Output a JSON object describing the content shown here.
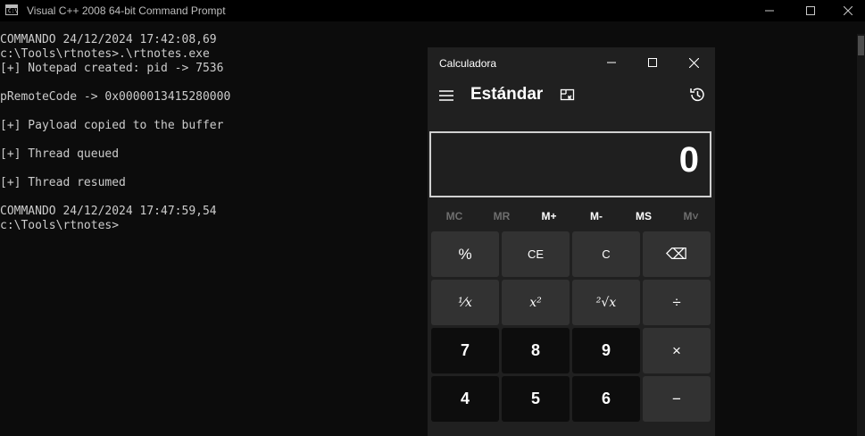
{
  "console": {
    "title": "Visual C++ 2008 64-bit Command Prompt",
    "lines": [
      "COMMANDO 24/12/2024 17:42:08,69",
      "c:\\Tools\\rtnotes>.\\rtnotes.exe",
      "[+] Notepad created: pid -> 7536",
      "",
      "pRemoteCode -> 0x0000013415280000",
      "",
      "[+] Payload copied to the buffer",
      "",
      "[+] Thread queued",
      "",
      "[+] Thread resumed",
      "",
      "COMMANDO 24/12/2024 17:47:59,54",
      "c:\\Tools\\rtnotes>"
    ]
  },
  "calculator": {
    "title": "Calculadora",
    "mode": "Estándar",
    "display": "0",
    "memory": [
      {
        "label": "MC",
        "enabled": false
      },
      {
        "label": "MR",
        "enabled": false
      },
      {
        "label": "M+",
        "enabled": true
      },
      {
        "label": "M-",
        "enabled": true
      },
      {
        "label": "MS",
        "enabled": true
      },
      {
        "label": "M˅",
        "enabled": false
      }
    ],
    "keys": [
      {
        "label": "%",
        "name": "percent-key",
        "style": "fn"
      },
      {
        "label": "CE",
        "name": "clear-entry-key",
        "style": "fn"
      },
      {
        "label": "C",
        "name": "clear-key",
        "style": "fn"
      },
      {
        "label": "⌫",
        "name": "backspace-key",
        "style": "fn",
        "icon": "backspace-icon"
      },
      {
        "label": "¹⁄x",
        "name": "reciprocal-key",
        "style": "fn"
      },
      {
        "label": "x²",
        "name": "square-key",
        "style": "fn"
      },
      {
        "label": "²√x",
        "name": "square-root-key",
        "style": "fn"
      },
      {
        "label": "÷",
        "name": "divide-key",
        "style": "fn"
      },
      {
        "label": "7",
        "name": "digit-7-key",
        "style": "num"
      },
      {
        "label": "8",
        "name": "digit-8-key",
        "style": "num"
      },
      {
        "label": "9",
        "name": "digit-9-key",
        "style": "num"
      },
      {
        "label": "×",
        "name": "multiply-key",
        "style": "fn"
      },
      {
        "label": "4",
        "name": "digit-4-key",
        "style": "num"
      },
      {
        "label": "5",
        "name": "digit-5-key",
        "style": "num"
      },
      {
        "label": "6",
        "name": "digit-6-key",
        "style": "num"
      },
      {
        "label": "−",
        "name": "minus-key",
        "style": "fn"
      }
    ]
  },
  "colors": {
    "console_bg": "#0c0c0c",
    "console_text": "#cccccc",
    "calc_bg": "#202020",
    "calc_fn_key": "#323232",
    "calc_num_key": "#0d0d0d",
    "mem_disabled": "#6e6e6e"
  }
}
